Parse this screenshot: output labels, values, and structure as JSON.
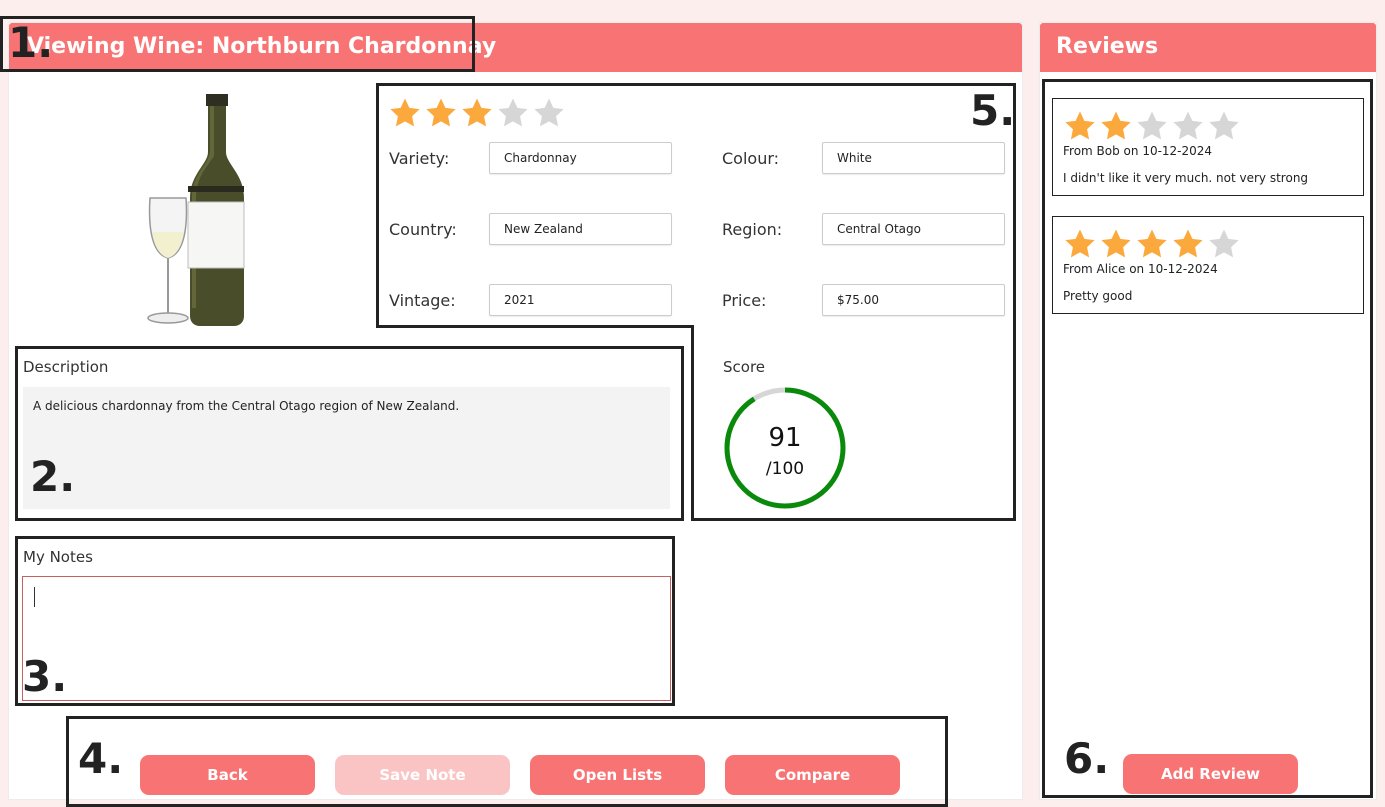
{
  "main": {
    "title": "Viewing Wine: Northburn Chardonnay",
    "rating": 3,
    "fields": {
      "variety_label": "Variety:",
      "variety_value": "Chardonnay",
      "colour_label": "Colour:",
      "colour_value": "White",
      "country_label": "Country:",
      "country_value": "New Zealand",
      "region_label": "Region:",
      "region_value": "Central Otago",
      "vintage_label": "Vintage:",
      "vintage_value": "2021",
      "price_label": "Price:",
      "price_value": "$75.00"
    },
    "description_label": "Description",
    "description_text": "A delicious chardonnay from the Central Otago region of New Zealand.",
    "notes_label": "My Notes",
    "notes_value": "",
    "score_label": "Score",
    "score_value": "91",
    "score_max": "/100",
    "score_fraction": 0.91,
    "buttons": {
      "back": "Back",
      "save_note": "Save Note",
      "open_lists": "Open Lists",
      "compare": "Compare"
    }
  },
  "reviews": {
    "title": "Reviews",
    "items": [
      {
        "rating": 2,
        "from": "From Bob on 10-12-2024",
        "text": "I didn't like it very much. not very strong"
      },
      {
        "rating": 4,
        "from": "From Alice on 10-12-2024",
        "text": "Pretty good"
      }
    ],
    "add_review": "Add Review"
  },
  "annotations": [
    "1.",
    "2.",
    "3.",
    "4.",
    "5.",
    "6."
  ],
  "colors": {
    "accent": "#f87474",
    "accent_disabled": "#fbc4c4",
    "star_filled": "#fba93c",
    "star_empty": "#d6d6d6",
    "score_ring": "#0a8a0a",
    "background": "#fdeeee"
  }
}
